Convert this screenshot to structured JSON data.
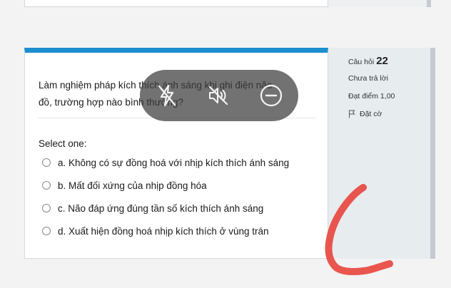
{
  "question": {
    "text_line1": "Làm nghiệm pháp kích thích ánh sáng khi ghi điện não",
    "text_line2": "đồ, trường hợp nào bình thường?",
    "prompt": "Select one:",
    "options": [
      "a. Không có sự đồng hoá với nhịp kích thích ánh sáng",
      "b. Mất đối xứng của nhịp đồng hóa",
      "c. Não đáp ứng đúng tần số kích thích ánh sáng",
      "d. Xuất hiện đồng hoá nhịp kích thích ở vùng trán"
    ]
  },
  "info": {
    "label": "Câu hỏi",
    "number": "22",
    "status": "Chưa trả lời",
    "marks": "Đạt điểm 1,00",
    "flag": "Đặt cờ"
  },
  "overlay": {
    "icons": [
      "flash-off-icon",
      "mute-icon",
      "minus-circle-icon"
    ]
  },
  "colors": {
    "accent": "#1d8fcf",
    "scribble": "#e8453c",
    "info_bg": "#e7ecef"
  }
}
